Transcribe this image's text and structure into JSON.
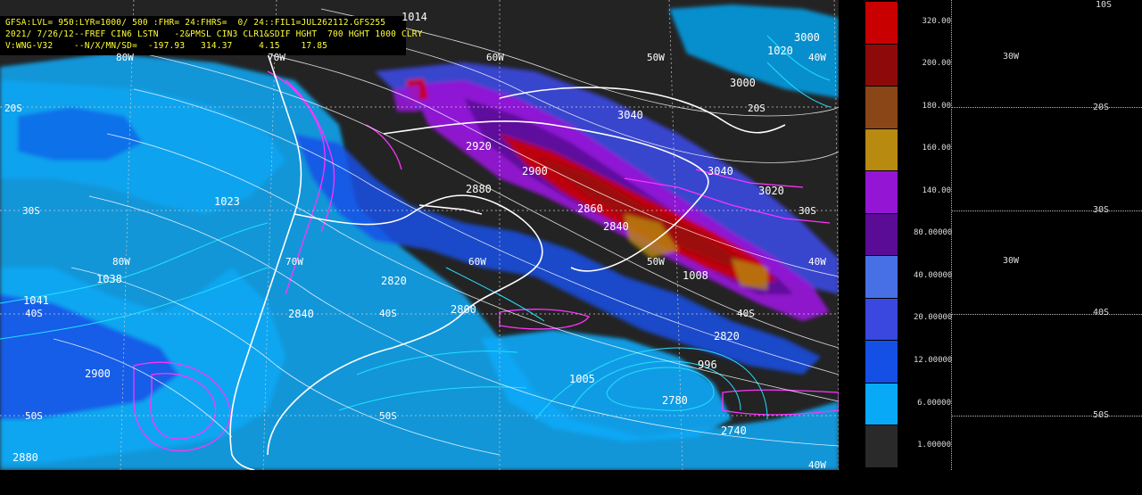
{
  "header": {
    "line1": "GFSA:LVL= 950:LYR=1000/ 500 :FHR= 24:FHRS=  0/ 24::FIL1=JUL262112.GFS255",
    "line2": "2021/ 7/26/12--FREF CIN6 LSTN   -2&PMSL CIN3 CLR1&SDIF HGHT  700 HGHT 1000 CLRY",
    "line3": "V:WNG-V32    --N/X/MN/SD=  -197.93   314.37     4.15    17.85"
  },
  "map_labels": {
    "lat_20s_west": "20S",
    "lat_20s_east": "20S",
    "lat_30s_west": "30S",
    "lat_30s_east": "30S",
    "lat_40s_west": "40S",
    "lat_40s_mid": "40S",
    "lat_40s_east": "40S",
    "lat_50s_west": "50S",
    "lat_50s_mid": "50S",
    "lon_80w_top": "80W",
    "lon_80w_mid": "80W",
    "lon_70w_top": "70W",
    "lon_70w_mid": "70W",
    "lon_60w_top": "60W",
    "lon_60w_mid": "60W",
    "lon_50w_top": "50W",
    "lon_50w_mid": "50W",
    "lon_40w_top": "40W",
    "lon_40w_mid": "40W",
    "lon_40w_bottom": "40W"
  },
  "contour_labels": {
    "h3000a": "3000",
    "h3000b": "3000",
    "h3040a": "3040",
    "h3040b": "3040",
    "h3020": "3020",
    "h2920": "2920",
    "h2900": "2900",
    "h2880": "2880",
    "h2860": "2860",
    "h2840a": "2840",
    "h2840b": "2840",
    "h2820a": "2820",
    "h2820b": "2820",
    "h2800": "2800",
    "h2780": "2780",
    "h2740": "2740",
    "h2900b": "2900",
    "h2880b": "2880",
    "p1014": "1014",
    "p1020": "1020",
    "p1023": "1023",
    "p1038": "1038",
    "p1041": "1041",
    "p1008": "1008",
    "p1005": "1005",
    "p996": "996"
  },
  "legend": {
    "colors": [
      "#c80000",
      "#8e0a0a",
      "#8a4616",
      "#b88a10",
      "#9416d4",
      "#5a0c96",
      "#4870e6",
      "#3a48e0",
      "#1450e6",
      "#08aaf8",
      "#2a2a2a"
    ],
    "values": [
      "320.00",
      "200.00",
      "180.00",
      "160.00",
      "140.00",
      "80.00000",
      "40.00000",
      "20.00000",
      "12.00000",
      "6.00000",
      "1.00000"
    ]
  },
  "right_panel": {
    "top_label": "10S",
    "lat_20s": "20S",
    "lat_30s": "30S",
    "lat_40s": "40S",
    "lat_50s": "50S",
    "lon_30w_top": "30W",
    "lon_30w_mid": "30W"
  }
}
